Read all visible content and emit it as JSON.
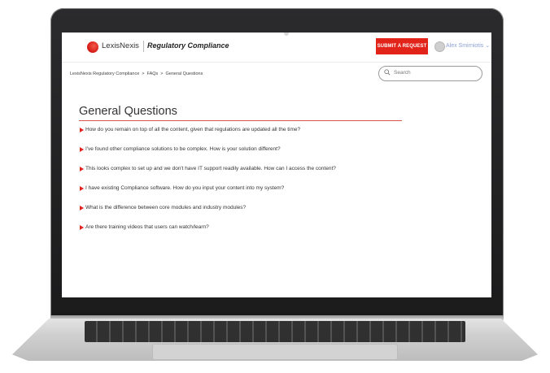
{
  "header": {
    "brand": "LexisNexis",
    "product": "Regulatory Compliance",
    "submit_label": "SUBMIT A REQUEST",
    "user_name": "Alex Smirniotis ⌄"
  },
  "breadcrumb": [
    "LexisNexis Regulatory Compliance",
    ">",
    "FAQs",
    ">",
    "General Questions"
  ],
  "search": {
    "placeholder": "Search"
  },
  "page": {
    "title": "General Questions",
    "questions": [
      "How do you remain on top of all the content, given that regulations are updated all the time?",
      "I've found other compliance solutions to be complex. How is your solution different?",
      "This looks complex to set up and we don't have IT support readily available. How can I access the content?",
      "I have existing Compliance software. How do you input your content into my system?",
      "What is the difference between core modules and industry modules?",
      "Are there training videos that users can watch/learn?"
    ]
  },
  "colors": {
    "accent": "#e2231a",
    "user_link": "#8a9fd6"
  }
}
